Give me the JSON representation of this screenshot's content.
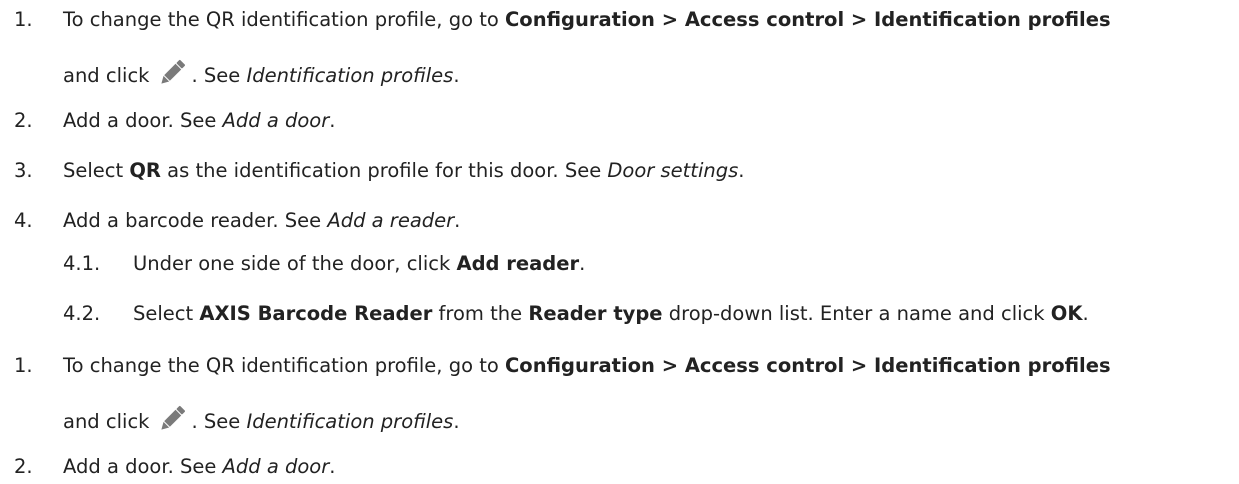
{
  "steps": [
    {
      "number": "1.",
      "prefix": "To change the QR identification profile, go to ",
      "path": "Configuration > Access control > Identification profiles",
      "cont_prefix": "and click",
      "icon": "pencil-icon",
      "cont_suffix": ". See ",
      "link": "Identification profiles",
      "end": "."
    },
    {
      "number": "2.",
      "prefix": "Add a door. See ",
      "link": "Add a door",
      "end": "."
    },
    {
      "number": "3.",
      "prefix": "Select ",
      "bold": "QR",
      "middle": " as the identification profile for this door. See ",
      "link": "Door settings",
      "end": "."
    },
    {
      "number": "4.",
      "prefix": "Add a barcode reader. See ",
      "link": "Add a reader",
      "end": ".",
      "substeps": [
        {
          "number": "4.1.",
          "prefix": "Under one side of the door, click ",
          "bold": "Add reader",
          "end": "."
        },
        {
          "number": "4.2.",
          "prefix": "Select ",
          "bold1": "AXIS Barcode Reader",
          "middle1": " from the ",
          "bold2": "Reader type",
          "middle2": " drop-down list. Enter a name and click ",
          "bold3": "OK",
          "end": "."
        }
      ]
    }
  ],
  "repeat_steps": [
    {
      "number": "1.",
      "prefix": "To change the QR identification profile, go to ",
      "path": "Configuration > Access control > Identification profiles",
      "cont_prefix": "and click",
      "icon": "pencil-icon",
      "cont_suffix": ". See ",
      "link": "Identification profiles",
      "end": "."
    },
    {
      "number": "2.",
      "prefix": "Add a door. See ",
      "link": "Add a door",
      "end": "."
    }
  ]
}
